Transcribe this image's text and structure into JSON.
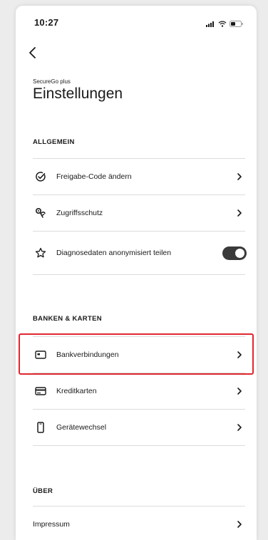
{
  "status_bar": {
    "time": "10:27",
    "icons": [
      "signal-icon",
      "wifi-icon",
      "battery-icon"
    ]
  },
  "header": {
    "back_icon": "chevron-left-icon",
    "subtitle": "SecureGo plus",
    "title": "Einstellungen"
  },
  "sections": [
    {
      "header": "ALLGEMEIN",
      "items": [
        {
          "label": "Freigabe-Code ändern",
          "icon": "check-circle-icon",
          "control": "chevron"
        },
        {
          "label": "Zugriffsschutz",
          "icon": "fingerprint-icon",
          "control": "chevron"
        },
        {
          "label": "Diagnosedaten anonymisiert teilen",
          "icon": "star-icon",
          "control": "toggle",
          "toggle_on": true
        }
      ]
    },
    {
      "header": "BANKEN & KARTEN",
      "items": [
        {
          "label": "Bankverbindungen",
          "icon": "bank-card-icon",
          "control": "chevron",
          "highlighted": true
        },
        {
          "label": "Kreditkarten",
          "icon": "credit-card-icon",
          "control": "chevron"
        },
        {
          "label": "Gerätewechsel",
          "icon": "phone-icon",
          "control": "chevron"
        }
      ]
    },
    {
      "header": "ÜBER",
      "items": [
        {
          "label": "Impressum",
          "icon": "",
          "control": "chevron"
        }
      ]
    }
  ],
  "colors": {
    "highlight": "#e0262e",
    "toggle_on": "#3a3a3a",
    "text": "#1a1a1a",
    "divider": "#dcdcdc"
  }
}
